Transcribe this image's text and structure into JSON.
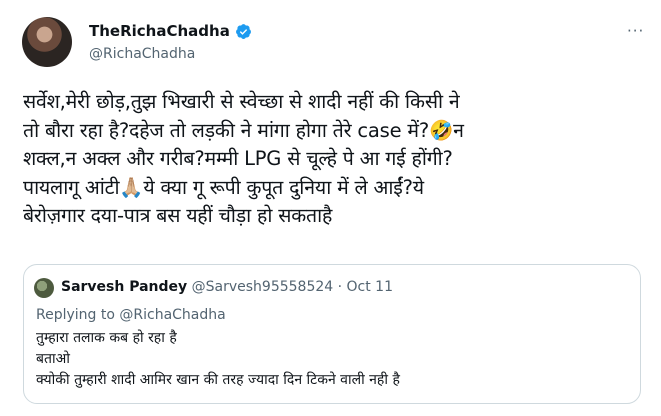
{
  "tweet": {
    "display_name": "TheRichaChadha",
    "handle": "@RichaChadha",
    "more_label": "···",
    "text": "सर्वेश,मेरी छोड़,तुझ भिखारी से स्वेच्छा से शादी नहीं की किसी ने\nतो बौरा रहा है?दहेज तो लड़की ने मांगा होगा तेरे case में?🤣न\nशक्ल,न अक्ल और गरीब?मम्मी LPG से चूल्हे पे आ गई होंगी?\nपायलागू आंटी🙏🏼ये क्या गू रूपी कुपूत दुनिया में ले आईं?ये\nबेरोज़गार दया-पात्र बस यहीं चौड़ा हो सकताहै"
  },
  "quoted": {
    "name": "Sarvesh Pandey",
    "meta": "@Sarvesh95558524 · Oct 11",
    "replying_prefix": "Replying to ",
    "replying_to": "@RichaChadha",
    "lines": [
      "तुम्हारा तलाक कब हो रहा है",
      "बताओ",
      "क्योकी तुम्हारी शादी आमिर खान की तरह ज्यादा दिन टिकने वाली नही है"
    ]
  },
  "icons": {
    "verified": "verified-badge-icon",
    "more": "more-options-icon"
  },
  "colors": {
    "text": "#0f1419",
    "secondary": "#536471",
    "verified_blue": "#1d9bf0",
    "quote_border": "#cfd9de"
  }
}
